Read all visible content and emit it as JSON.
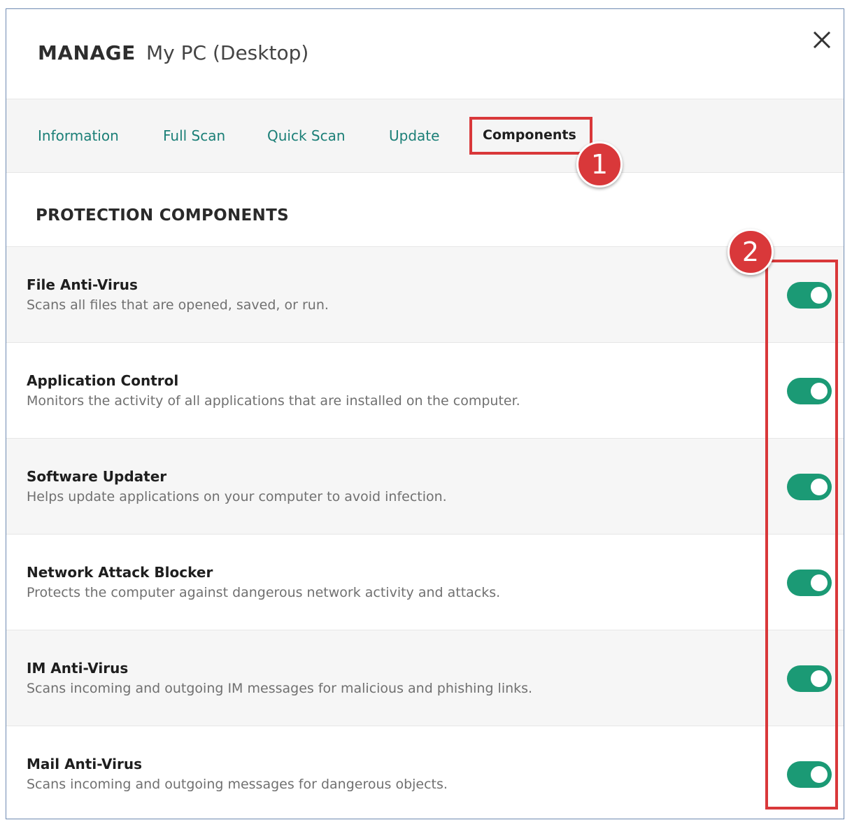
{
  "header": {
    "title": "MANAGE",
    "subtitle": "My PC (Desktop)",
    "close_icon": "close-icon"
  },
  "tabs": [
    {
      "label": "Information",
      "active": false
    },
    {
      "label": "Full Scan",
      "active": false
    },
    {
      "label": "Quick Scan",
      "active": false
    },
    {
      "label": "Update",
      "active": false
    },
    {
      "label": "Components",
      "active": true
    }
  ],
  "section": {
    "title": "PROTECTION COMPONENTS"
  },
  "components": [
    {
      "name": "File Anti-Virus",
      "description": "Scans all files that are opened, saved, or run.",
      "enabled": true
    },
    {
      "name": "Application Control",
      "description": "Monitors the activity of all applications that are installed on the computer.",
      "enabled": true
    },
    {
      "name": "Software Updater",
      "description": "Helps update applications on your computer to avoid infection.",
      "enabled": true
    },
    {
      "name": "Network Attack Blocker",
      "description": "Protects the computer against dangerous network activity and attacks.",
      "enabled": true
    },
    {
      "name": "IM Anti-Virus",
      "description": "Scans incoming and outgoing IM messages for malicious and phishing links.",
      "enabled": true
    },
    {
      "name": "Mail Anti-Virus",
      "description": "Scans incoming and outgoing messages for dangerous objects.",
      "enabled": true
    }
  ],
  "annotations": {
    "step1": "1",
    "step2": "2"
  },
  "colors": {
    "accent": "#1b9a75",
    "tab_link": "#1b7f77",
    "annotation": "#d9383a"
  }
}
